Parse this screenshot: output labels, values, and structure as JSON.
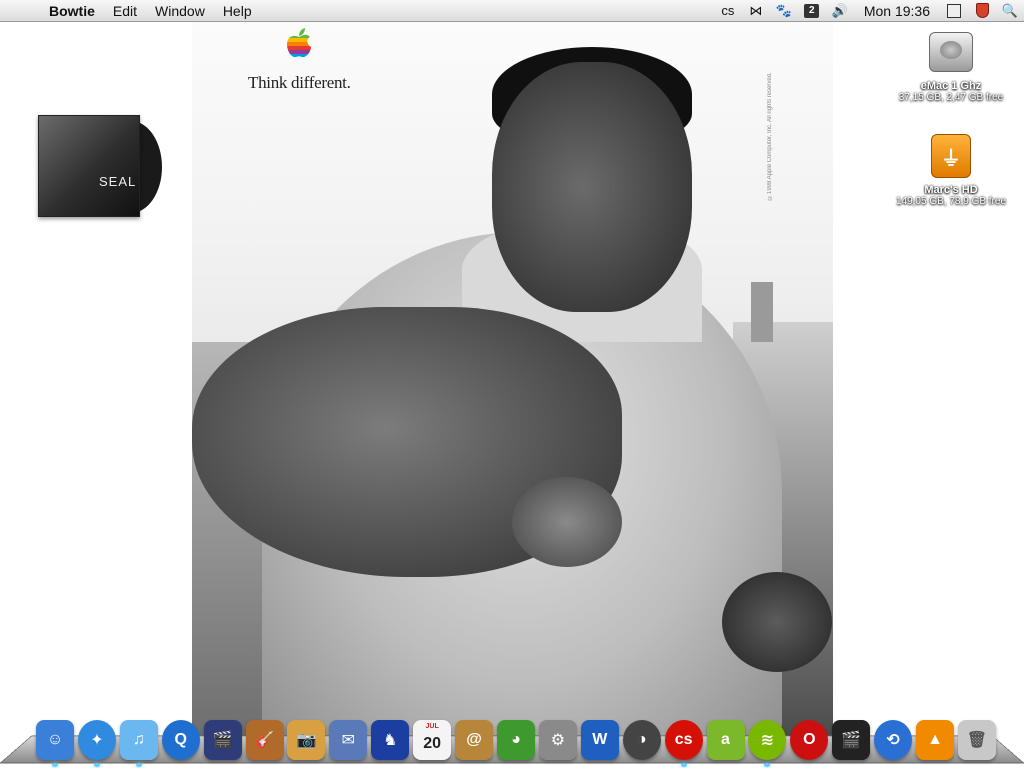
{
  "menubar": {
    "apple_glyph": "",
    "app_name": "Bowtie",
    "menus": [
      "Edit",
      "Window",
      "Help"
    ],
    "status_icons": [
      {
        "name": "lastfm-icon",
        "glyph": "cs"
      },
      {
        "name": "bowtie-icon",
        "glyph": "⋈"
      },
      {
        "name": "paw-icon",
        "glyph": "🐾"
      },
      {
        "name": "translate-icon",
        "glyph": "2"
      },
      {
        "name": "volume-icon",
        "glyph": "🔊"
      }
    ],
    "clock": "Mon 19:36",
    "search_glyph": "🔍"
  },
  "wallpaper": {
    "tagline": "Think different.",
    "copyright": "©1998 Apple Computer, Inc. All rights reserved."
  },
  "desktop": {
    "album": {
      "text": "SEAL"
    },
    "drives": [
      {
        "name": "eMac 1 Ghz",
        "info": "37,15 GB, 2,47 GB free"
      },
      {
        "name": "Marc's HD",
        "info": "149,05 GB, 78,9 GB free",
        "glyph": "⏚"
      }
    ]
  },
  "dock": {
    "items": [
      {
        "name": "finder-icon",
        "glyph": "☺",
        "color": "#3a7fd8"
      },
      {
        "name": "safari-icon",
        "glyph": "✦",
        "color": "#2f8ae0"
      },
      {
        "name": "itunes-icon",
        "glyph": "♫",
        "color": "#6bb8f0"
      },
      {
        "name": "quicktime-icon",
        "glyph": "Q",
        "color": "#1e6fd0"
      },
      {
        "name": "imovie-icon",
        "glyph": "🎬",
        "color": "#2e3d7a"
      },
      {
        "name": "garageband-icon",
        "glyph": "🎸",
        "color": "#b06a2a"
      },
      {
        "name": "iphoto-icon",
        "glyph": "📷",
        "color": "#d8a040"
      },
      {
        "name": "mail-icon",
        "glyph": "✉",
        "color": "#5a79b8"
      },
      {
        "name": "growl-icon",
        "glyph": "♞",
        "color": "#1a3fa0"
      },
      {
        "name": "ical-icon",
        "glyph": "20",
        "month": "JUL",
        "color": "#f4f4f4"
      },
      {
        "name": "address-book-icon",
        "glyph": "@",
        "color": "#b8863a"
      },
      {
        "name": "adium-icon",
        "glyph": "◕",
        "color": "#3e9a2e"
      },
      {
        "name": "system-preferences-icon",
        "glyph": "⚙",
        "color": "#8a8a8a"
      },
      {
        "name": "wiki-icon",
        "glyph": "W",
        "color": "#1f5fbf"
      },
      {
        "name": "camino-icon",
        "glyph": "◑",
        "color": "#444444"
      },
      {
        "name": "lastfm-app-icon",
        "glyph": "cs",
        "color": "#d51007"
      },
      {
        "name": "amazon-mp3-icon",
        "glyph": "a",
        "color": "#7bb82a"
      },
      {
        "name": "spotify-icon",
        "glyph": "≋",
        "color": "#7ab800"
      },
      {
        "name": "opera-icon",
        "glyph": "O",
        "color": "#cc1010"
      },
      {
        "name": "front-row-icon",
        "glyph": "🎬",
        "color": "#222222"
      },
      {
        "name": "time-machine-icon",
        "glyph": "⟲",
        "color": "#2a6fd4"
      },
      {
        "name": "vlc-icon",
        "glyph": "▲",
        "color": "#f28a00"
      },
      {
        "name": "trash-icon",
        "glyph": "🗑",
        "color": "#c8c8c8"
      }
    ]
  }
}
